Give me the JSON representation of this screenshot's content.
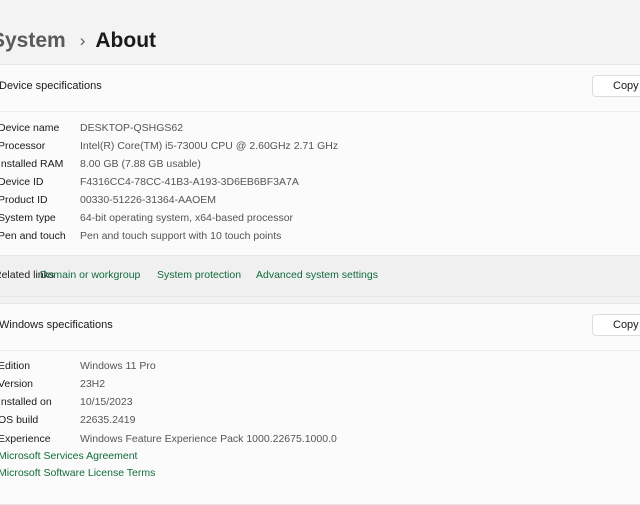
{
  "breadcrumb": {
    "parent": "System",
    "separator": "›",
    "current": "About"
  },
  "device_specs": {
    "title": "Device specifications",
    "copy_label": "Copy",
    "rows": [
      {
        "label": "Device name",
        "value": "DESKTOP-QSHGS62"
      },
      {
        "label": "Processor",
        "value": "Intel(R) Core(TM) i5-7300U CPU @ 2.60GHz   2.71 GHz"
      },
      {
        "label": "Installed RAM",
        "value": "8.00 GB (7.88 GB usable)"
      },
      {
        "label": "Device ID",
        "value": "F4316CC4-78CC-41B3-A193-3D6EB6BF3A7A"
      },
      {
        "label": "Product ID",
        "value": "00330-51226-31364-AAOEM"
      },
      {
        "label": "System type",
        "value": "64-bit operating system, x64-based processor"
      },
      {
        "label": "Pen and touch",
        "value": "Pen and touch support with 10 touch points"
      }
    ]
  },
  "related_links": {
    "label": "Related links",
    "links": [
      "Domain or workgroup",
      "System protection",
      "Advanced system settings"
    ]
  },
  "windows_specs": {
    "title": "Windows specifications",
    "copy_label": "Copy",
    "rows": [
      {
        "label": "Edition",
        "value": "Windows 11 Pro"
      },
      {
        "label": "Version",
        "value": "23H2"
      },
      {
        "label": "Installed on",
        "value": "10/15/2023"
      },
      {
        "label": "OS build",
        "value": "22635.2419"
      },
      {
        "label": "Experience",
        "value": "Windows Feature Experience Pack 1000.22675.1000.0"
      }
    ],
    "links": [
      "Microsoft Services Agreement",
      "Microsoft Software License Terms"
    ]
  }
}
